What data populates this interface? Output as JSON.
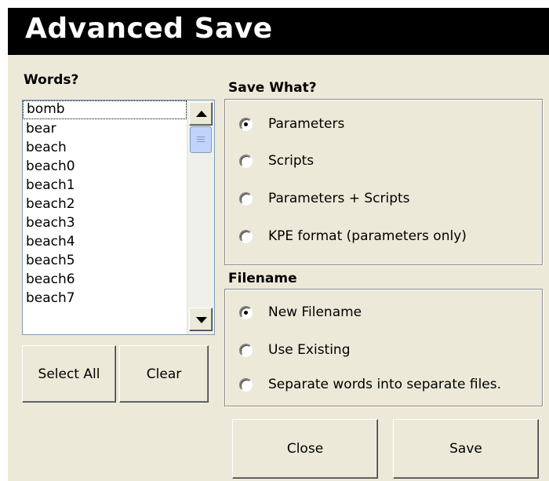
{
  "window": {
    "title": "Advanced Save"
  },
  "words": {
    "label": "Words?",
    "items": [
      "bomb",
      "bear",
      "beach",
      "beach0",
      "beach1",
      "beach2",
      "beach3",
      "beach4",
      "beach5",
      "beach6",
      "beach7"
    ],
    "focused_item": "bomb",
    "select_all_label": "Select All",
    "clear_label": "Clear"
  },
  "save_what": {
    "label": "Save What?",
    "options": [
      "Parameters",
      "Scripts",
      "Parameters + Scripts",
      "KPE format (parameters only)"
    ],
    "selected": "Parameters"
  },
  "filename": {
    "label": "Filename",
    "options": [
      "New Filename",
      "Use Existing",
      "Separate words into separate files."
    ],
    "selected": "New Filename"
  },
  "actions": {
    "close_label": "Close",
    "save_label": "Save"
  }
}
